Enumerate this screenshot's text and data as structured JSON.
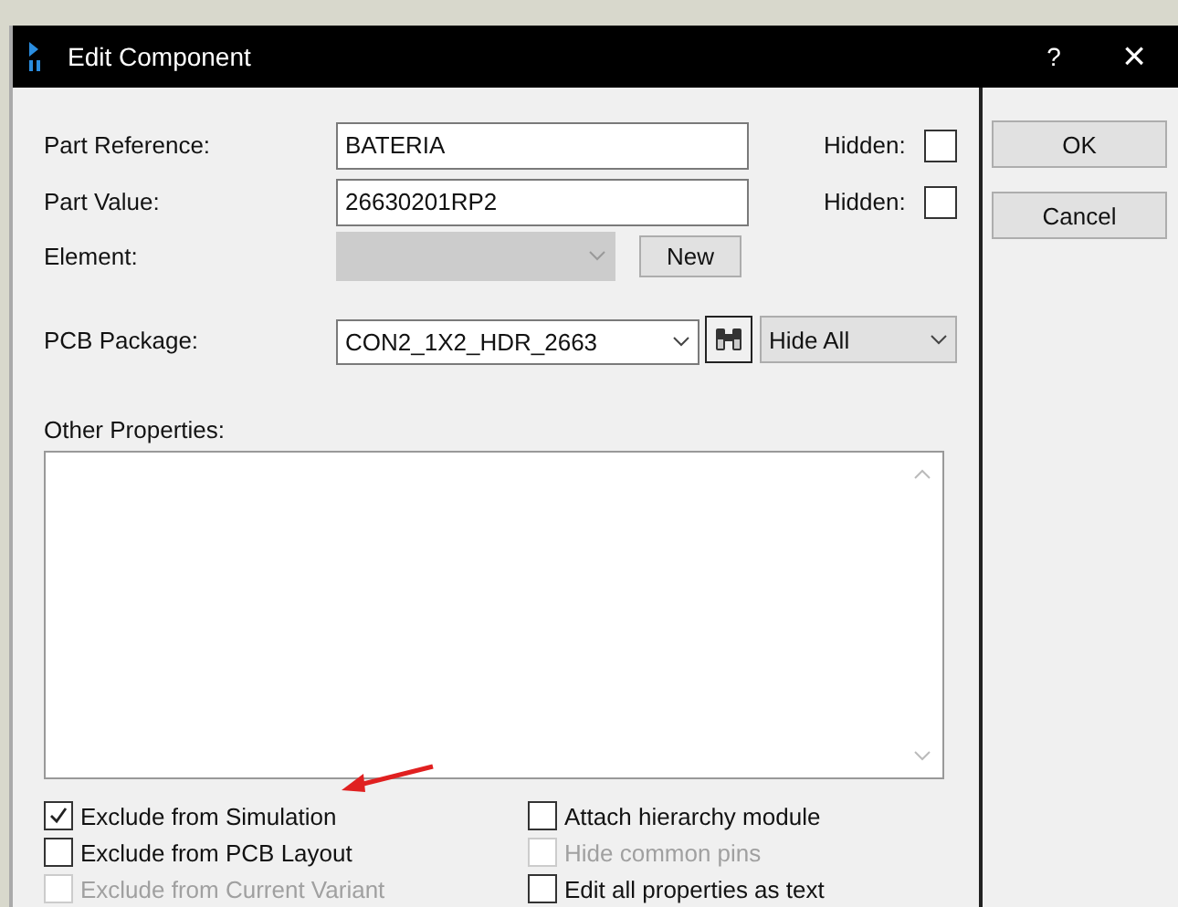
{
  "window": {
    "title": "Edit Component",
    "help": "?",
    "close": "×"
  },
  "fields": [
    {
      "kind": "text",
      "label": "Part Reference:",
      "value": "BATERIA",
      "hidden_label": "Hidden:",
      "hidden": false
    },
    {
      "kind": "text",
      "label": "Part Value:",
      "value": "26630201RP2",
      "hidden_label": "Hidden:",
      "hidden": false
    },
    {
      "kind": "combo",
      "label": "Element:",
      "disabled": true,
      "button": "New"
    },
    {
      "kind": "package",
      "label": "PCB Package:",
      "value": "CON2_1X2_HDR_2663",
      "option": "Hide All"
    }
  ],
  "other_properties": {
    "label": "Other Properties:"
  },
  "options_left": [
    {
      "label": "Exclude from Simulation",
      "checked": true,
      "disabled": false
    },
    {
      "label": "Exclude from PCB Layout",
      "checked": false,
      "disabled": false
    },
    {
      "label": "Exclude from Current Variant",
      "checked": false,
      "disabled": true
    }
  ],
  "options_right": [
    {
      "label": "Attach hierarchy module",
      "checked": false,
      "disabled": false
    },
    {
      "label": "Hide common pins",
      "checked": false,
      "disabled": true
    },
    {
      "label": "Edit all properties as text",
      "checked": false,
      "disabled": false
    }
  ],
  "buttons": [
    "OK",
    "Cancel"
  ]
}
